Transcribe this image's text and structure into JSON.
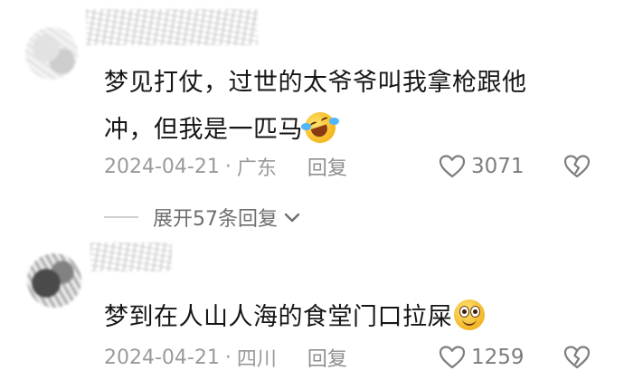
{
  "comments": [
    {
      "text": "梦见打仗，过世的太爷爷叫我拿枪跟他冲，但我是一匹马",
      "emoji": "laughing-crying-face-emoji",
      "date": "2024-04-21",
      "location": "广东",
      "reply_label": "回复",
      "likes": "3071",
      "expand_replies_label": "展开57条回复"
    },
    {
      "text": "梦到在人山人海的食堂门口拉屎",
      "emoji": "grinning-face-emoji",
      "date": "2024-04-21",
      "location": "四川",
      "reply_label": "回复",
      "likes": "1259"
    }
  ],
  "separator": "·",
  "icons": {
    "like": "heart-outline-icon",
    "dislike": "broken-heart-icon",
    "expand": "chevron-down-icon"
  },
  "colors": {
    "text": "#161616",
    "meta": "#9a9a9a",
    "icon": "#7d7d7d"
  }
}
